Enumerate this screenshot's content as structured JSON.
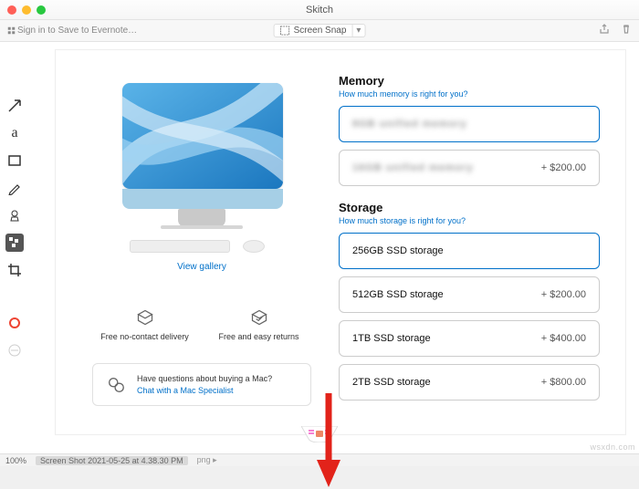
{
  "window": {
    "title": "Skitch"
  },
  "toolbar": {
    "signin": "Sign in to Save to Evernote…",
    "snap_label": "Screen Snap"
  },
  "product": {
    "gallery_link": "View gallery"
  },
  "features": {
    "delivery": "Free no-contact delivery",
    "returns": "Free and easy returns"
  },
  "questions": {
    "line1": "Have questions about buying a Mac?",
    "line2": "Chat with a Mac Specialist"
  },
  "config": {
    "memory": {
      "title": "Memory",
      "helper": "How much memory is right for you?",
      "options": [
        {
          "label": "8GB unified memory",
          "price": "",
          "selected": true,
          "blurred": true
        },
        {
          "label": "16GB unified memory",
          "price": "+ $200.00",
          "selected": false,
          "blurred": true
        }
      ]
    },
    "storage": {
      "title": "Storage",
      "helper": "How much storage is right for you?",
      "options": [
        {
          "label": "256GB SSD storage",
          "price": "",
          "selected": true
        },
        {
          "label": "512GB SSD storage",
          "price": "+ $200.00",
          "selected": false
        },
        {
          "label": "1TB SSD storage",
          "price": "+ $400.00",
          "selected": false
        },
        {
          "label": "2TB SSD storage",
          "price": "+ $800.00",
          "selected": false
        }
      ]
    }
  },
  "status": {
    "zoom": "100%",
    "filename": "Screen Shot 2021-05-25 at 4.38.30 PM",
    "ext": "png"
  },
  "watermark": "wsxdn.com"
}
